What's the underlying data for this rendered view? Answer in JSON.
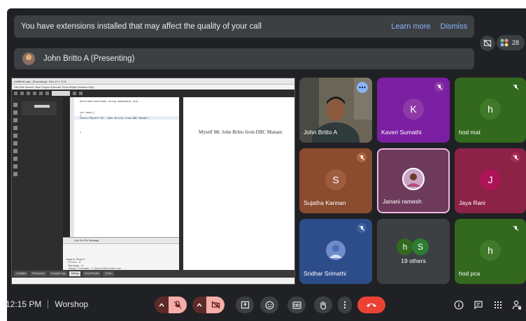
{
  "banner": {
    "message": "You have extensions installed that may affect the quality of your call",
    "learn_more": "Learn more",
    "dismiss": "Dismiss"
  },
  "people_count": "28",
  "presenter": {
    "label": "John Britto A (Presenting)"
  },
  "shared_screen": {
    "window_title": "Untitled1.cpp - [Executing] - Dev-C++ 5.11",
    "menu": "File  Edit  Search  View  Project  Execute  Tools  AStyle  Window  Help",
    "compiler_dropdown": "TDM-GCC 4.9.2 64-bit Release",
    "code_lines": [
      "#include<iostream> using namespace std;",
      "int main()",
      "{",
      "  cout<<\"Myself Mr. John Britto from DBC Manam\";",
      "}"
    ],
    "output_text": "Myself Mr. John Britto from DBC Manam",
    "output_panel_headers": "Line    Col    File    Message",
    "compile_log": [
      "Compile Result:",
      "- Errors: 0",
      "- Warnings: 0",
      "- Output Filename: C:\\Users\\Untitled1.exe",
      "- Output Size: 1.83 MiB",
      "- Compilation Time: 0.66s"
    ],
    "status_tabs": [
      "Compiler",
      "Resources",
      "Compile Log",
      "Debug",
      "Find Results",
      "Close"
    ]
  },
  "participants": [
    {
      "name": "John Britto A",
      "initial": "",
      "bg": "#5a5347",
      "type": "video",
      "muted": false
    },
    {
      "name": "Kaveri Sumathi",
      "initial": "K",
      "bg": "#7b1fa2",
      "avatar_bg": "#8e3aa6",
      "muted": true
    },
    {
      "name": "hod mat",
      "initial": "h",
      "bg": "#33691e",
      "avatar_bg": "#3f7a2a",
      "muted": true
    },
    {
      "name": "Sujatha Kannan",
      "initial": "S",
      "bg": "#8a4b2f",
      "avatar_bg": "#a05c3e",
      "muted": true
    },
    {
      "name": "Janani ramesh",
      "initial": "",
      "bg": "#6d3a5c",
      "avatar_bg": "#c9a4c3",
      "muted": false,
      "highlighted": true
    },
    {
      "name": "Jaya Rani",
      "initial": "J",
      "bg": "#8c2246",
      "avatar_bg": "#ad1457",
      "muted": true
    },
    {
      "name": "Sridhar Srimathi",
      "initial": "",
      "bg": "#2c4d8a",
      "avatar_bg": "#6f8ccd",
      "muted": true
    },
    {
      "name": "19 others",
      "initials": [
        "h",
        "S"
      ],
      "bg": "#3c4043",
      "muted": false
    },
    {
      "name": "hod pca",
      "initial": "h",
      "bg": "#33691e",
      "avatar_bg": "#3f7a2a",
      "muted": true
    }
  ],
  "footer": {
    "time": "12:15 PM",
    "meeting_name": "Worshop"
  },
  "colors": {
    "accent_blue": "#8ab4f8",
    "end_red": "#ea4335",
    "mute_pink": "#f6aea9"
  }
}
